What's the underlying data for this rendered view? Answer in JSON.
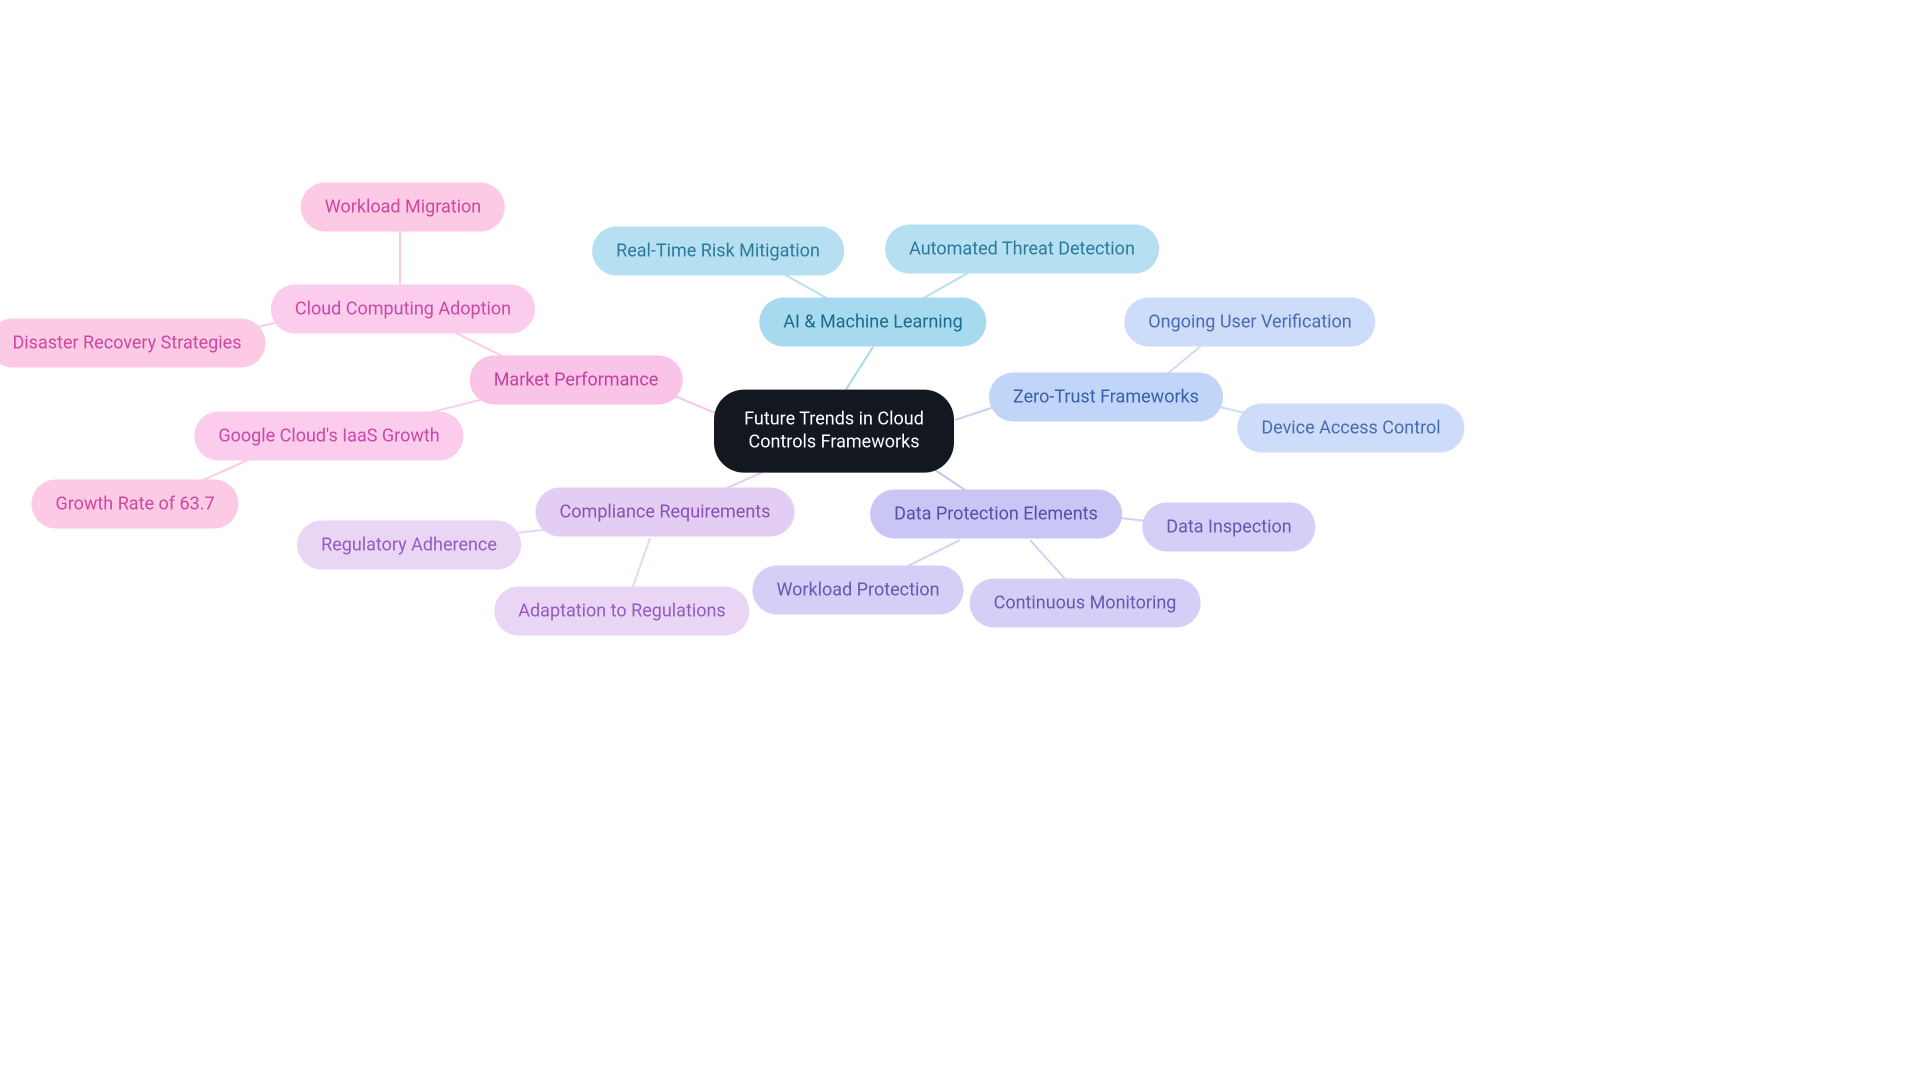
{
  "root": {
    "label": "Future Trends in Cloud Controls Frameworks"
  },
  "ai": {
    "label": "AI & Machine Learning",
    "leaves": {
      "threat": "Automated Threat Detection",
      "risk": "Real-Time Risk Mitigation"
    }
  },
  "zerotrust": {
    "label": "Zero-Trust Frameworks",
    "leaves": {
      "user": "Ongoing User Verification",
      "device": "Device Access Control"
    }
  },
  "dataprot": {
    "label": "Data Protection Elements",
    "leaves": {
      "inspect": "Data Inspection",
      "monitor": "Continuous Monitoring",
      "workload": "Workload Protection"
    }
  },
  "compliance": {
    "label": "Compliance Requirements",
    "leaves": {
      "adapt": "Adaptation to Regulations",
      "adhere": "Regulatory Adherence"
    }
  },
  "market": {
    "label": "Market Performance",
    "leaves": {
      "ccadopt": "Cloud Computing Adoption",
      "iaas": "Google Cloud's IaaS Growth"
    }
  },
  "ccadopt_leaves": {
    "migration": "Workload Migration",
    "dr": "Disaster Recovery Strategies"
  },
  "iaas_leaves": {
    "growth": "Growth Rate of 63.7"
  }
}
